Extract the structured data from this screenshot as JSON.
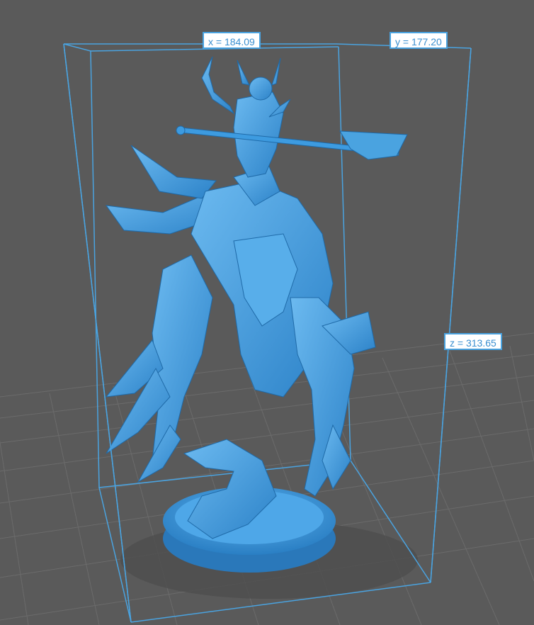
{
  "viewport": {
    "background_color": "#5a5a5a",
    "grid_color": "#6a6a6a",
    "model_color": "#3d9be0",
    "bbox_color": "#4aa3e0"
  },
  "dimensions": {
    "x_label": "x = 184.09",
    "y_label": "y = 177.20",
    "z_label": "z = 313.65"
  }
}
